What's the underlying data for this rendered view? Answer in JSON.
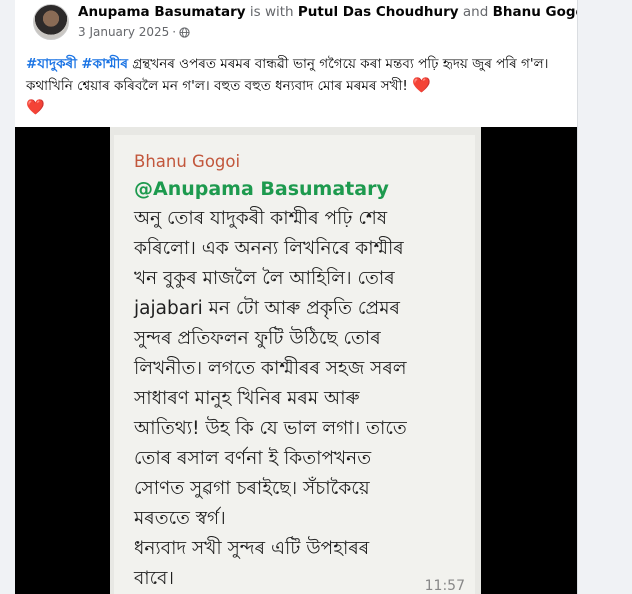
{
  "post": {
    "author": "Anupama Basumatary",
    "with_word": "is with",
    "tagged_1": "Putul Das Choudhury",
    "and_word": "and",
    "tagged_2": "Bhanu Gogoi",
    "period": ".",
    "date": "3 January 2025",
    "dot": "·",
    "audience_icon": "globe-icon",
    "caption_tag_1": "#যাদুকৰী",
    "caption_tag_2": "#কাশ্মীৰ",
    "caption_text": " গ্ৰন্থখনৰ ওপৰত মৰমৰ বান্ধৱী ভানু গগৈয়ে কৰা মন্তব্য পঢ়ি হৃদয় জুৰ পৰি গ'ল। কথাখিনি শ্বেয়াৰ কৰিবলৈ মন গ'ল। বহুত বহুত ধন্যবাদ মোৰ মৰমৰ সখী!",
    "heart_1": "❤️",
    "heart_2": "❤️"
  },
  "image": {
    "sender": "Bhanu Gogoi",
    "mention": "@Anupama Basumatary",
    "message": "অনু  তোৰ যাদুকৰী কাশ্মীৰ পঢ়ি শেষ\nকৰিলো।  এক অনন্য লিখনিৰে কাশ্মীৰ\nখন বুকুৰ মাজলৈ লৈ আহিলি। তোৰ\njajabari মন টো আৰু প্ৰকৃতি প্ৰেমৰ\nসুন্দৰ প্ৰতিফলন ফুটি উঠিছে তোৰ\nলিখনীত। লগতে কাশ্মীৰৰ সহজ সৰল\nসাধাৰণ মানুহ খিনিৰ মৰম আৰু\nআতিথ্য! উহ কি যে ভাল লগা।  তাতে\nতোৰ ৰসাল বৰ্ণনা ই  কিতাপখনত\nসোণত সুৱগা চৰাইছে।  সঁচাকৈয়ে\nমৰততে  স্বৰ্গ।\n ধন্যবাদ সখী সুন্দৰ এটি উপহাৰৰ\nবাবে।",
    "time": "11:57"
  },
  "colors": {
    "tag_blue": "#1b74e4",
    "sender_color": "#c2573c",
    "mention_color": "#1d9a4e",
    "heart_red": "#e41e3f"
  }
}
